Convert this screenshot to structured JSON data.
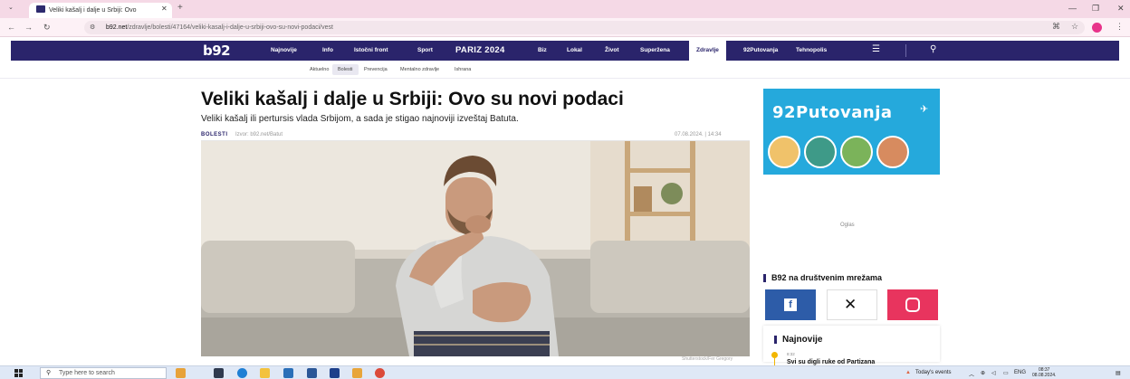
{
  "browser": {
    "tab_title": "Veliki kašalj i dalje u Srbiji: Ovo",
    "url_host": "b92.net",
    "url_path": "/zdravlje/bolesti/47164/veliki-kasalj-i-dalje-u-srbiji-ovo-su-novi-podaci/vest"
  },
  "site": {
    "logo": "b92",
    "nav": [
      "Najnovije",
      "Info",
      "Istočni front",
      "Sport",
      "PARIZ 2024",
      "Biz",
      "Lokal",
      "Život",
      "Superžena",
      "Zdravlje",
      "92Putovanja",
      "Tehnopolis"
    ],
    "active_nav": "Zdravlje",
    "subnav": [
      "Aktuelno",
      "Bolesti",
      "Prevencija",
      "Mentalno zdravlje",
      "Ishrana"
    ],
    "active_subnav": "Bolesti"
  },
  "article": {
    "headline": "Veliki kašalj i dalje u Srbiji: Ovo su novi podaci",
    "lead": "Veliki kašalj ili pertursis vlada Srbijom, a sada je stigao najnoviji izveštaj Batuta.",
    "category": "BOLESTI",
    "source": "Izvor: b92.net/Batut",
    "date": "07.08.2024. | 14:34",
    "photo_credit": "Shutterstock/Fer Gregory"
  },
  "sidebar": {
    "promo_title": "92Putovanja",
    "ad_label": "Oglas",
    "social_title": "B92 na društvenim mrežama",
    "latest_title": "Najnovije",
    "latest_time": "8:32",
    "latest_item": "Svi su digli ruke od Partizana"
  },
  "taskbar": {
    "search_placeholder": "Type here to search",
    "events": "Today's events",
    "lang": "ENG",
    "time": "08:37",
    "date": "08.08.2024."
  },
  "colors": {
    "brand": "#2a246b",
    "promo": "#25a9dc",
    "facebook": "#2d5ca8",
    "instagram": "#e8345e",
    "accent": "#f2b600"
  }
}
